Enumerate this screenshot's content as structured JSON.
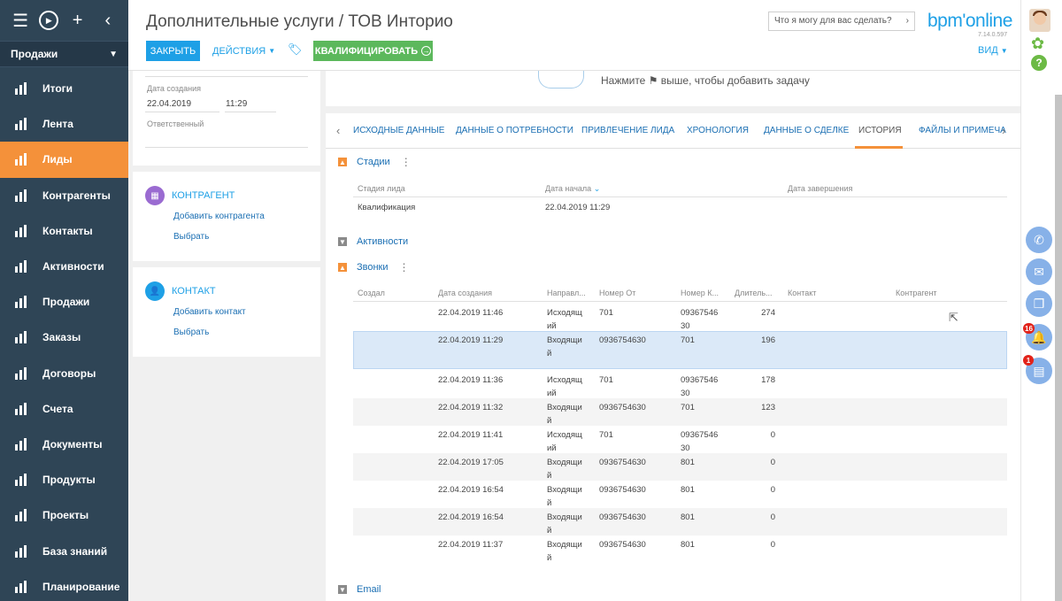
{
  "sidebar": {
    "workspace": "Продажи",
    "items": [
      {
        "label": "Итоги",
        "icon": "bar-chart-icon"
      },
      {
        "label": "Лента",
        "icon": "chat-bubbles-icon"
      },
      {
        "label": "Лиды",
        "icon": "lead-icon"
      },
      {
        "label": "Контрагенты",
        "icon": "building-icon"
      },
      {
        "label": "Контакты",
        "icon": "person-icon"
      },
      {
        "label": "Активности",
        "icon": "flag-icon"
      },
      {
        "label": "Продажи",
        "icon": "funnel-icon"
      },
      {
        "label": "Заказы",
        "icon": "cart-icon"
      },
      {
        "label": "Договоры",
        "icon": "contract-icon"
      },
      {
        "label": "Счета",
        "icon": "coins-icon"
      },
      {
        "label": "Документы",
        "icon": "document-icon"
      },
      {
        "label": "Продукты",
        "icon": "products-icon"
      },
      {
        "label": "Проекты",
        "icon": "gantt-icon"
      },
      {
        "label": "База знаний",
        "icon": "book-icon"
      },
      {
        "label": "Планирование",
        "icon": "planning-chart-icon"
      }
    ]
  },
  "header": {
    "title": "Дополнительные услуги / ТОВ Инторио",
    "close_label": "ЗАКРЫТЬ",
    "actions_label": "ДЕЙСТВИЯ",
    "qualify_label": "КВАЛИФИЦИРОВАТЬ",
    "search_text": "Что я могу для вас сделать?",
    "logo": "bpm'online",
    "version": "7.14.0.597",
    "view_label": "ВИД"
  },
  "info": {
    "created_label": "Дата создания",
    "created_date": "22.04.2019",
    "created_time": "11:29",
    "owner_label": "Ответственный"
  },
  "account_block": {
    "title": "КОНТРАГЕНТ",
    "add": "Добавить контрагента",
    "select": "Выбрать"
  },
  "contact_block": {
    "title": "КОНТАКТ",
    "add": "Добавить контакт",
    "select": "Выбрать"
  },
  "task_hint": "Нажмите ⚑ выше, чтобы добавить задачу",
  "tabs": [
    "ИСХОДНЫЕ ДАННЫЕ",
    "ДАННЫЕ О ПОТРЕБНОСТИ",
    "ПРИВЛЕЧЕНИЕ ЛИДА",
    "ХРОНОЛОГИЯ",
    "ДАННЫЕ О СДЕЛКЕ",
    "ИСТОРИЯ",
    "ФАЙЛЫ И ПРИМЕЧА"
  ],
  "active_tab": "ИСТОРИЯ",
  "stages": {
    "title": "Стадии",
    "columns": [
      "Стадия лида",
      "Дата начала",
      "Дата завершения"
    ],
    "rows": [
      [
        "Квалификация",
        "22.04.2019 11:29",
        ""
      ]
    ]
  },
  "activities": {
    "title": "Активности"
  },
  "calls": {
    "title": "Звонки",
    "columns": [
      "Создал",
      "Дата создания",
      "Направл...",
      "Номер От",
      "Номер К...",
      "Длитель...",
      "Контакт",
      "Контрагент"
    ],
    "rows": [
      {
        "created": "22.04.2019 11:46",
        "dir1": "Исходящ",
        "dir2": "ий",
        "from": "701",
        "to1": "09367546",
        "to2": "30",
        "dur": "274"
      },
      {
        "created": "22.04.2019 11:29",
        "dir1": "Входящи",
        "dir2": "й",
        "from": "0936754630",
        "to1": "701",
        "to2": "",
        "dur": "196"
      },
      {
        "created": "22.04.2019 11:36",
        "dir1": "Исходящ",
        "dir2": "ий",
        "from": "701",
        "to1": "09367546",
        "to2": "30",
        "dur": "178"
      },
      {
        "created": "22.04.2019 11:32",
        "dir1": "Входящи",
        "dir2": "й",
        "from": "0936754630",
        "to1": "701",
        "to2": "",
        "dur": "123"
      },
      {
        "created": "22.04.2019 11:41",
        "dir1": "Исходящ",
        "dir2": "ий",
        "from": "701",
        "to1": "09367546",
        "to2": "30",
        "dur": "0"
      },
      {
        "created": "22.04.2019 17:05",
        "dir1": "Входящи",
        "dir2": "й",
        "from": "0936754630",
        "to1": "801",
        "to2": "",
        "dur": "0"
      },
      {
        "created": "22.04.2019 16:54",
        "dir1": "Входящи",
        "dir2": "й",
        "from": "0936754630",
        "to1": "801",
        "to2": "",
        "dur": "0"
      },
      {
        "created": "22.04.2019 16:54",
        "dir1": "Входящи",
        "dir2": "й",
        "from": "0936754630",
        "to1": "801",
        "to2": "",
        "dur": "0"
      },
      {
        "created": "22.04.2019 11:37",
        "dir1": "Входящи",
        "dir2": "й",
        "from": "0936754630",
        "to1": "801",
        "to2": "",
        "dur": "0"
      }
    ]
  },
  "email": {
    "title": "Email"
  },
  "rail": {
    "notifications_badge": "16",
    "feed_badge": "1"
  },
  "colors": {
    "sidebar": "#2f4556",
    "accent": "#1ea0e6",
    "active": "#f4913a",
    "success": "#5cb85c"
  }
}
